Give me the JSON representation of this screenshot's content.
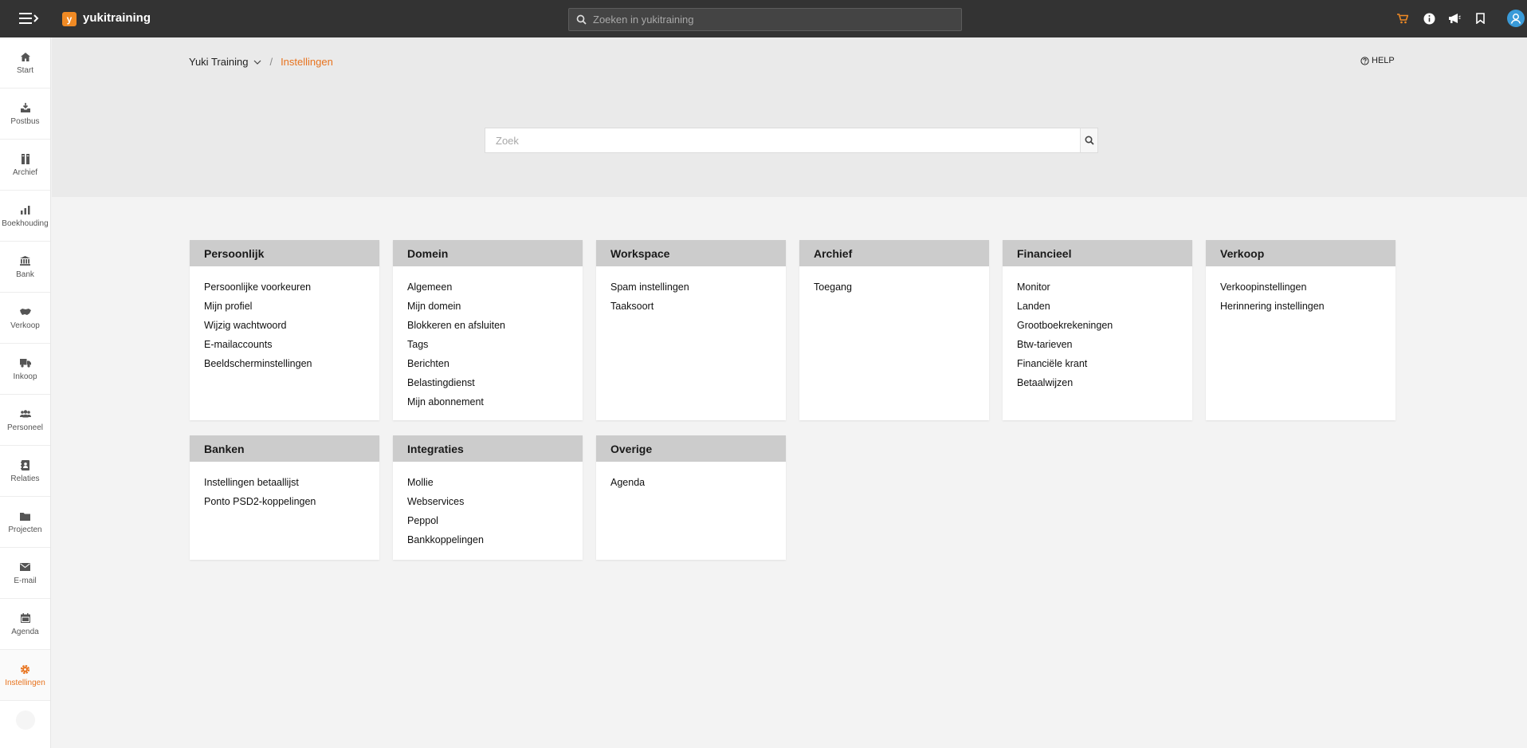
{
  "app": {
    "name": "yukitraining",
    "logo_letter": "y"
  },
  "topbar": {
    "search_placeholder": "Zoeken in yukitraining",
    "icons": [
      "cart-icon",
      "info-icon",
      "megaphone-icon",
      "bookmark-icon",
      "user-avatar-icon"
    ]
  },
  "sidebar": {
    "items": [
      {
        "label": "Start",
        "icon": "home-icon"
      },
      {
        "label": "Postbus",
        "icon": "inbox-icon"
      },
      {
        "label": "Archief",
        "icon": "archive-icon"
      },
      {
        "label": "Boekhouding",
        "icon": "bar-chart-icon"
      },
      {
        "label": "Bank",
        "icon": "bank-icon"
      },
      {
        "label": "Verkoop",
        "icon": "handshake-icon"
      },
      {
        "label": "Inkoop",
        "icon": "truck-icon"
      },
      {
        "label": "Personeel",
        "icon": "people-icon"
      },
      {
        "label": "Relaties",
        "icon": "contact-book-icon"
      },
      {
        "label": "Projecten",
        "icon": "folder-icon"
      },
      {
        "label": "E-mail",
        "icon": "envelope-icon"
      },
      {
        "label": "Agenda",
        "icon": "calendar-icon"
      },
      {
        "label": "Instellingen",
        "icon": "gear-icon",
        "active": true
      }
    ]
  },
  "breadcrumb": {
    "root": "Yuki Training",
    "separator": "/",
    "current": "Instellingen"
  },
  "help_label": "HELP",
  "main_search_placeholder": "Zoek",
  "colors": {
    "accent": "#e8731e",
    "topbar": "#333333",
    "card_header": "#cccccc"
  },
  "cards": [
    {
      "title": "Persoonlijk",
      "links": [
        "Persoonlijke voorkeuren",
        "Mijn profiel",
        "Wijzig wachtwoord",
        "E-mailaccounts",
        "Beeldscherminstellingen"
      ]
    },
    {
      "title": "Domein",
      "links": [
        "Algemeen",
        "Mijn domein",
        "Blokkeren en afsluiten",
        "Tags",
        "Berichten",
        "Belastingdienst",
        "Mijn abonnement"
      ]
    },
    {
      "title": "Workspace",
      "links": [
        "Spam instellingen",
        "Taaksoort"
      ]
    },
    {
      "title": "Archief",
      "links": [
        "Toegang"
      ]
    },
    {
      "title": "Financieel",
      "links": [
        "Monitor",
        "Landen",
        "Grootboekrekeningen",
        "Btw-tarieven",
        "Financiële krant",
        "Betaalwijzen"
      ]
    },
    {
      "title": "Verkoop",
      "links": [
        "Verkoopinstellingen",
        "Herinnering instellingen"
      ]
    },
    {
      "title": "Banken",
      "links": [
        "Instellingen betaallijst",
        "Ponto PSD2-koppelingen"
      ]
    },
    {
      "title": "Integraties",
      "links": [
        "Mollie",
        "Webservices",
        "Peppol",
        "Bankkoppelingen"
      ]
    },
    {
      "title": "Overige",
      "links": [
        "Agenda"
      ]
    }
  ]
}
